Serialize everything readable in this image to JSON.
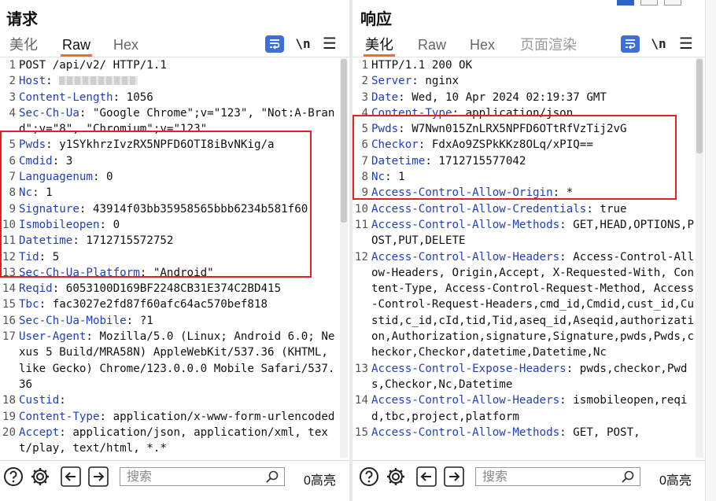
{
  "request": {
    "title": "请求",
    "tabs": [
      {
        "label": "美化",
        "active": false
      },
      {
        "label": "Raw",
        "active": true
      },
      {
        "label": "Hex",
        "active": false
      }
    ],
    "newline_label": "\\n",
    "menu_label": "☰",
    "lines": [
      {
        "n": "1",
        "key": "",
        "val": "POST /api/v2/ HTTP/1.1"
      },
      {
        "n": "2",
        "key": "Host",
        "val": "",
        "redacted": true
      },
      {
        "n": "3",
        "key": "Content-Length",
        "val": " 1056"
      },
      {
        "n": "4",
        "key": "Sec-Ch-Ua",
        "val": " \"Google Chrome\";v=\"123\", \"Not:A-Brand\";v=\"8\", \"Chromium\";v=\"123\""
      },
      {
        "n": "5",
        "key": "Pwds",
        "val": " y1SYkhrzIvzRX5NPFD6OTI8iBvNKig/a"
      },
      {
        "n": "6",
        "key": "Cmdid",
        "val": " 3"
      },
      {
        "n": "7",
        "key": "Languagenum",
        "val": " 0"
      },
      {
        "n": "8",
        "key": "Nc",
        "val": " 1"
      },
      {
        "n": "9",
        "key": "Signature",
        "val": " 43914f03bb35958565bbb6234b581f60"
      },
      {
        "n": "10",
        "key": "Ismobileopen",
        "val": " 0"
      },
      {
        "n": "11",
        "key": "Datetime",
        "val": " 1712715572752"
      },
      {
        "n": "12",
        "key": "Tid",
        "val": " 5"
      },
      {
        "n": "13",
        "key": "Sec-Ch-Ua-Platform",
        "val": " \"Android\""
      },
      {
        "n": "14",
        "key": "Reqid",
        "val": " 6053100D169BF2248CB31E374C2BD415"
      },
      {
        "n": "15",
        "key": "Tbc",
        "val": " fac3027e2fd87f60afc64ac570bef818"
      },
      {
        "n": "16",
        "key": "Sec-Ch-Ua-Mobile",
        "val": " ?1"
      },
      {
        "n": "17",
        "key": "User-Agent",
        "val": " Mozilla/5.0 (Linux; Android 6.0; Nexus 5 Build/MRA58N) AppleWebKit/537.36 (KHTML, like Gecko) Chrome/123.0.0.0 Mobile Safari/537.36"
      },
      {
        "n": "18",
        "key": "Custid",
        "val": ""
      },
      {
        "n": "19",
        "key": "Content-Type",
        "val": " application/x-www-form-urlencoded"
      },
      {
        "n": "20",
        "key": "Accept",
        "val": " application/json, application/xml, text/play, text/html, *.*"
      }
    ],
    "search_placeholder": "搜索",
    "highlight_count": "0高亮"
  },
  "response": {
    "title": "响应",
    "tabs": [
      {
        "label": "美化",
        "active": true
      },
      {
        "label": "Raw",
        "active": false
      },
      {
        "label": "Hex",
        "active": false
      },
      {
        "label": "页面渲染",
        "active": false,
        "muted": true
      }
    ],
    "newline_label": "\\n",
    "menu_label": "☰",
    "lines": [
      {
        "n": "1",
        "key": "",
        "val": "HTTP/1.1 200 OK"
      },
      {
        "n": "2",
        "key": "Server",
        "val": " nginx"
      },
      {
        "n": "3",
        "key": "Date",
        "val": " Wed, 10 Apr 2024 02:19:37 GMT"
      },
      {
        "n": "4",
        "key": "Content-Type",
        "val": " application/json"
      },
      {
        "n": "5",
        "key": "Pwds",
        "val": " W7Nwn015ZnLRX5NPFD6OTtRfVzTij2vG"
      },
      {
        "n": "6",
        "key": "Checkor",
        "val": " FdxAo9ZSPkKKz8OLq/xPIQ=="
      },
      {
        "n": "7",
        "key": "Datetime",
        "val": " 1712715577042"
      },
      {
        "n": "8",
        "key": "Nc",
        "val": " 1"
      },
      {
        "n": "9",
        "key": "Access-Control-Allow-Origin",
        "val": " *"
      },
      {
        "n": "10",
        "key": "Access-Control-Allow-Credentials",
        "val": " true"
      },
      {
        "n": "11",
        "key": "Access-Control-Allow-Methods",
        "val": " GET,HEAD,OPTIONS,POST,PUT,DELETE"
      },
      {
        "n": "12",
        "key": "Access-Control-Allow-Headers",
        "val": " Access-Control-Allow-Headers, Origin,Accept, X-Requested-With, Content-Type, Access-Control-Request-Method, Access-Control-Request-Headers,cmd_id,Cmdid,cust_id,Custid,c_id,cId,tid,Tid,aseq_id,Aseqid,authorization,Authorization,signature,Signature,pwds,Pwds,checkor,Checkor,datetime,Datetime,Nc"
      },
      {
        "n": "13",
        "key": "Access-Control-Expose-Headers",
        "val": " pwds,checkor,Pwds,Checkor,Nc,Datetime"
      },
      {
        "n": "14",
        "key": "Access-Control-Allow-Headers",
        "val": " ismobileopen,reqid,tbc,project,platform"
      },
      {
        "n": "15",
        "key": "Access-Control-Allow-Methods",
        "val": " GET, POST,"
      }
    ],
    "search_placeholder": "搜索",
    "highlight_count": "0高亮"
  },
  "colors": {
    "header_key": "#1f3fbf",
    "highlight_box": "#e62020",
    "active_tab": "#ff6633",
    "wrap_button": "#3f6fd6"
  },
  "icons": [
    "help-icon",
    "settings-icon",
    "arrow-left-icon",
    "arrow-right-icon",
    "search-icon",
    "wrap-icon",
    "menu-icon"
  ]
}
